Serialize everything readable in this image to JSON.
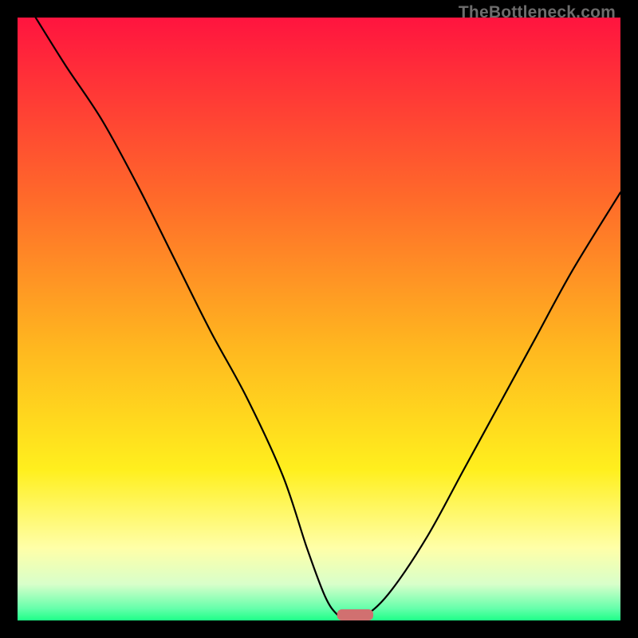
{
  "watermark": "TheBottleneck.com",
  "colors": {
    "red_top": "#ff143f",
    "orange": "#ff9a1f",
    "yellow": "#ffef1e",
    "pale_yellow": "#ffffa8",
    "pale_green": "#c0ffc0",
    "green": "#1eff88",
    "curve": "#000000",
    "trough": "#d17070",
    "frame": "#000000"
  },
  "chart_data": {
    "type": "line",
    "title": "",
    "xlabel": "",
    "ylabel": "",
    "xlim": [
      0,
      100
    ],
    "ylim": [
      0,
      100
    ],
    "x": [
      3,
      8,
      14,
      20,
      26,
      32,
      38,
      44,
      48,
      51,
      53,
      55,
      58,
      62,
      68,
      74,
      80,
      86,
      92,
      100
    ],
    "values": [
      100,
      92,
      83,
      72,
      60,
      48,
      37,
      24,
      12,
      4,
      1,
      0,
      1,
      5,
      14,
      25,
      36,
      47,
      58,
      71
    ],
    "trough_marker": {
      "x_start": 53,
      "x_end": 59,
      "y": 0
    },
    "annotations": []
  }
}
